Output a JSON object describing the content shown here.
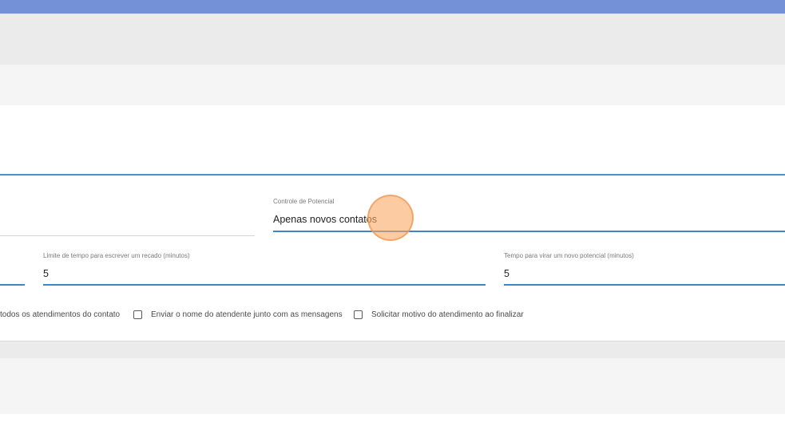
{
  "form": {
    "potencial": {
      "label": "Controle de Potencial",
      "value": "Apenas novos contatos"
    },
    "limite_tempo": {
      "label": "Limite de tempo para escrever um recado (minutos)",
      "value": "5"
    },
    "tempo_potencial": {
      "label": "Tempo para virar um novo potencial (minutos)",
      "value": "5"
    },
    "checkboxes": [
      {
        "label": "todos os atendimentos do contato",
        "checked": false
      },
      {
        "label": "Enviar o nome do atendente junto com as mensagens",
        "checked": false
      },
      {
        "label": "Solicitar motivo do atendimento ao finalizar",
        "checked": false
      }
    ]
  },
  "colors": {
    "accent": "#3d86c8",
    "topbar": "#7490d6",
    "cursor": "#faa864"
  }
}
